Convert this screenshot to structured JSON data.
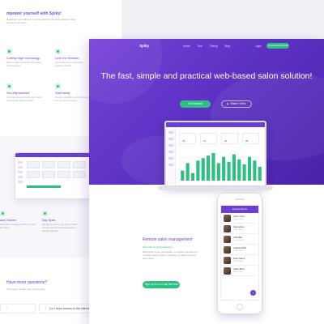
{
  "left_page": {
    "heading": "mpower yourself with Spiky!",
    "subtext": "Redefined your software a new generation in booking software online the day to the world",
    "features": [
      {
        "title": "Cutting edge technology",
        "desc": "Built on modern cloud tech & the latest tools for growth"
      },
      {
        "title": "Love the freedom",
        "desc": "It is mobile so you can access it anywhere anytime"
      },
      {
        "title": "Security assured",
        "desc": "Your data is in good hands, your client's personal data safe and secure"
      },
      {
        "title": "Start today",
        "desc": "We are so confident you'll love it we give it to you free for 14 days"
      }
    ],
    "features2": [
      {
        "title": "auty Salons",
        "desc": "Appointment booking and client records for salons"
      },
      {
        "title": "Day Spas",
        "desc": "Manage the guests, pay, sale of health services you can reach the website of beautiful software"
      }
    ],
    "questions_title": "Have more questions?",
    "questions_sub": "One system to take care of everything",
    "faqs": [
      "",
      "Do I need access to the internet to use Neko"
    ]
  },
  "right_page": {
    "nav": {
      "logo": "Spiky",
      "items": [
        "Home",
        "Tour",
        "Pricing",
        "Blog"
      ],
      "login": "Login",
      "cta": "Create an account"
    },
    "hero_title": "The fast, simple and practical web-based salon solution!",
    "buttons": {
      "start": "Get Started",
      "video": "Watch Video"
    },
    "laptop": {
      "app_name": "Spiky",
      "cards": [
        "05",
        "12",
        "03",
        "08"
      ],
      "bars": [
        8,
        14,
        6,
        16,
        18,
        20,
        22,
        14,
        19,
        15,
        21,
        17,
        13,
        19,
        16,
        11
      ]
    },
    "remote": {
      "title": "Remote salon management",
      "subtitle": "Work with no strings attached",
      "desc": "Neko works on any web browser, so whether you work from a mobile, laptop or tablet, managing your salon has never been easier.",
      "button": "Sign up for a 14 day free trial"
    },
    "phone": {
      "header": "Recent Clients",
      "rows": [
        {
          "name": "Arlene Sims",
          "sub": "10:00 - 12:30"
        },
        {
          "name": "Kate Adams",
          "sub": "12:30 - 13:00"
        },
        {
          "name": "Aida Mills",
          "sub": "13:00 - 13:30"
        },
        {
          "name": "Leland Hobbs",
          "sub": "13:30 - 14:00"
        },
        {
          "name": "Rose Salons",
          "sub": "14:00 - 14:30"
        },
        {
          "name": "Calvin Beck",
          "sub": "14:30 - 15:00"
        }
      ],
      "fab": "+"
    }
  },
  "colors": {
    "purple": "#6b3fd0",
    "hero_gradient_start": "#7640d8",
    "hero_gradient_end": "#4a22a8",
    "green": "#2ec082",
    "background": "#f1f0f5"
  }
}
